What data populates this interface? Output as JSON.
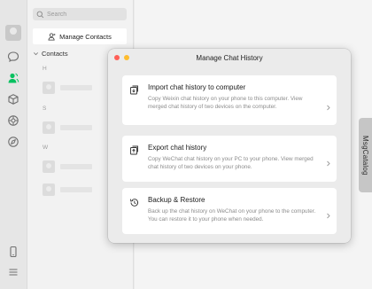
{
  "search": {
    "placeholder": "Search"
  },
  "contacts_pane": {
    "manage_button_label": "Manage Contacts",
    "section_label": "Contacts",
    "letters": [
      "H",
      "S",
      "W"
    ]
  },
  "modal": {
    "title": "Manage Chat History",
    "cards": [
      {
        "icon": "import-icon",
        "title": "Import chat history to computer",
        "description": "Copy Weixin chat history on your phone to this computer. View merged chat history of two devices on the computer."
      },
      {
        "icon": "export-icon",
        "title": "Export chat history",
        "description": "Copy WeChat chat history on your PC to your phone. View merged chat history of two devices on your phone."
      },
      {
        "icon": "history-restore-icon",
        "title": "Backup & Restore",
        "description": "Back up the chat history on WeChat on your phone to the computer. You can restore it to your phone when needed."
      }
    ]
  },
  "side_tab": {
    "label": "MsgCatalog"
  },
  "colors": {
    "window_close": "#ff5f57",
    "window_minimize": "#febc2e",
    "contacts_active": "#07c160"
  }
}
